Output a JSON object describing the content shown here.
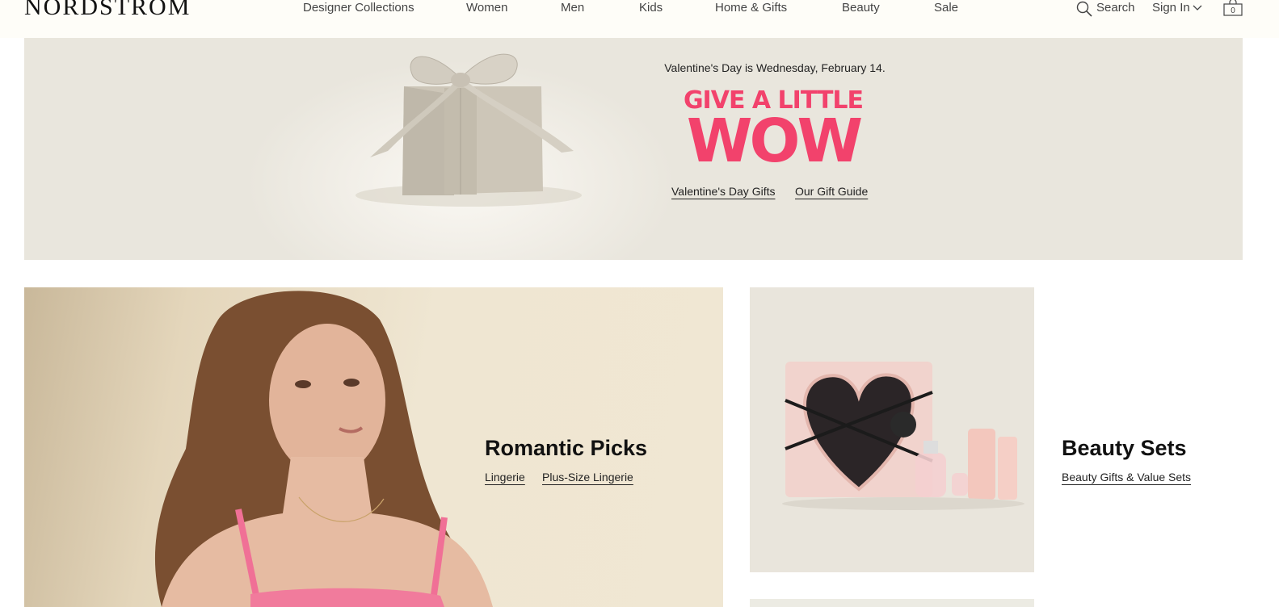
{
  "header": {
    "logo": "NORDSTROM",
    "nav": [
      "Designer Collections",
      "Women",
      "Men",
      "Kids",
      "Home & Gifts",
      "Beauty",
      "Sale"
    ],
    "search_label": "Search",
    "signin_label": "Sign In",
    "bag_count": "0"
  },
  "hero": {
    "date_text": "Valentine's Day is Wednesday, February 14.",
    "headline_line1": "GIVE A LITTLE",
    "headline_line2": "WOW",
    "headline_color": "#f2426c",
    "links": [
      "Valentine's Day Gifts",
      "Our Gift Guide"
    ]
  },
  "romantic": {
    "title": "Romantic Picks",
    "links": [
      "Lingerie",
      "Plus-Size Lingerie"
    ]
  },
  "beauty": {
    "title": "Beauty Sets",
    "link": "Beauty Gifts & Value Sets"
  },
  "icons": {
    "search": "search-icon",
    "signin_chevron": "chevron-down-icon",
    "bag": "shopping-bag-icon"
  }
}
